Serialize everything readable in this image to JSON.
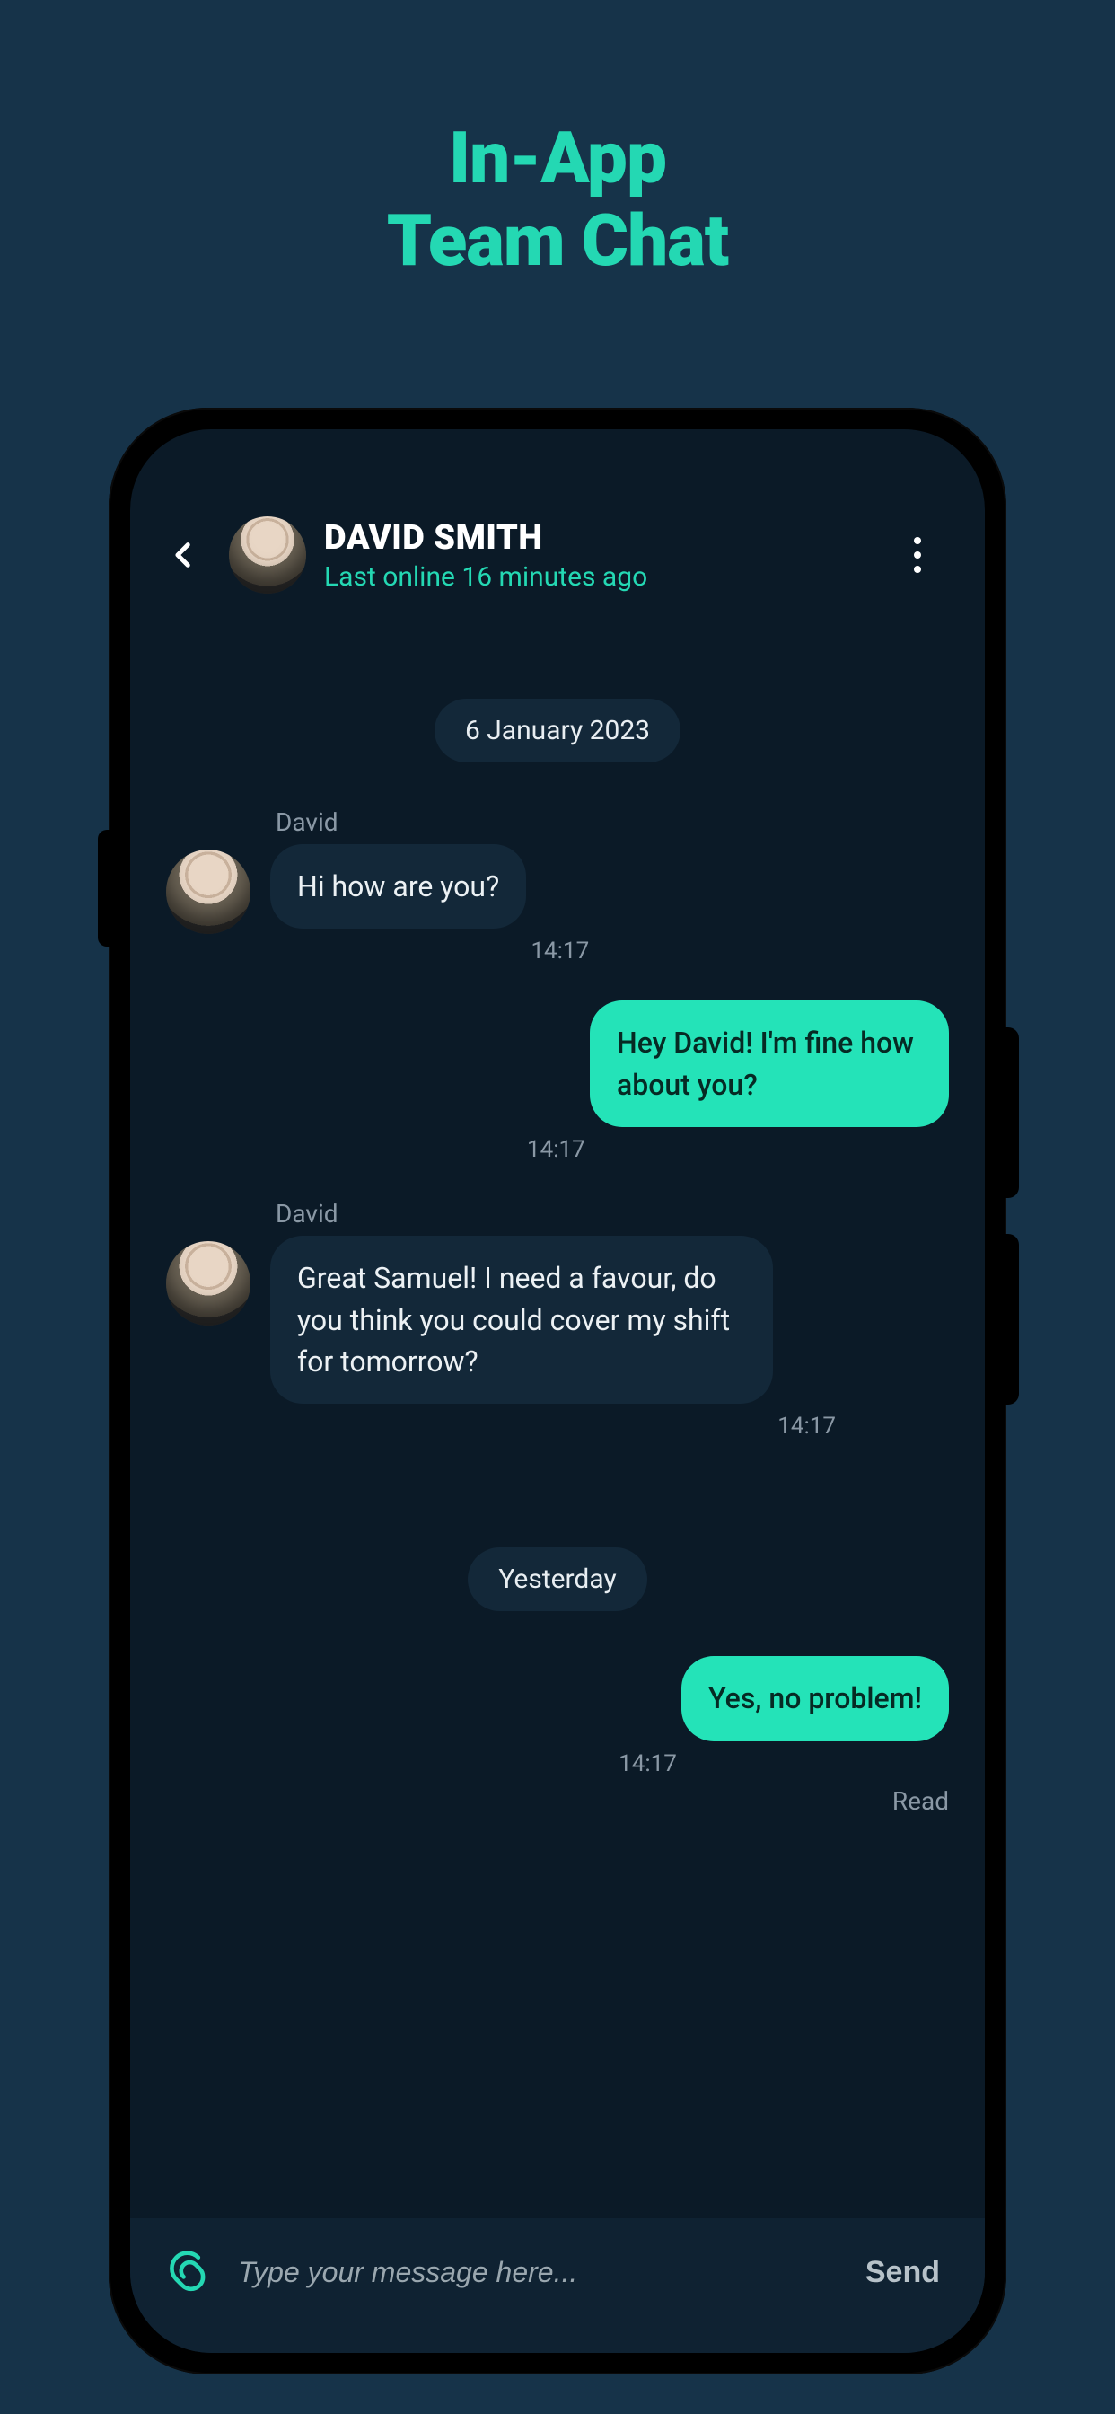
{
  "hero": {
    "line1": "In-App",
    "line2": "Team Chat"
  },
  "header": {
    "name": "DAVID SMITH",
    "status": "Last online 16 minutes ago"
  },
  "dates": {
    "d1": "6 January 2023",
    "d2": "Yesterday"
  },
  "messages": {
    "m1": {
      "sender": "David",
      "text": "Hi how are you?",
      "time": "14:17"
    },
    "m2": {
      "text": "Hey David! I'm fine how about you?",
      "time": "14:17"
    },
    "m3": {
      "sender": "David",
      "text": "Great Samuel! I need a favour, do you think you could cover my shift for tomorrow?",
      "time": "14:17"
    },
    "m4": {
      "text": "Yes, no problem!",
      "time": "14:17",
      "status": "Read"
    }
  },
  "input": {
    "placeholder": "Type your message here...",
    "send": "Send"
  }
}
